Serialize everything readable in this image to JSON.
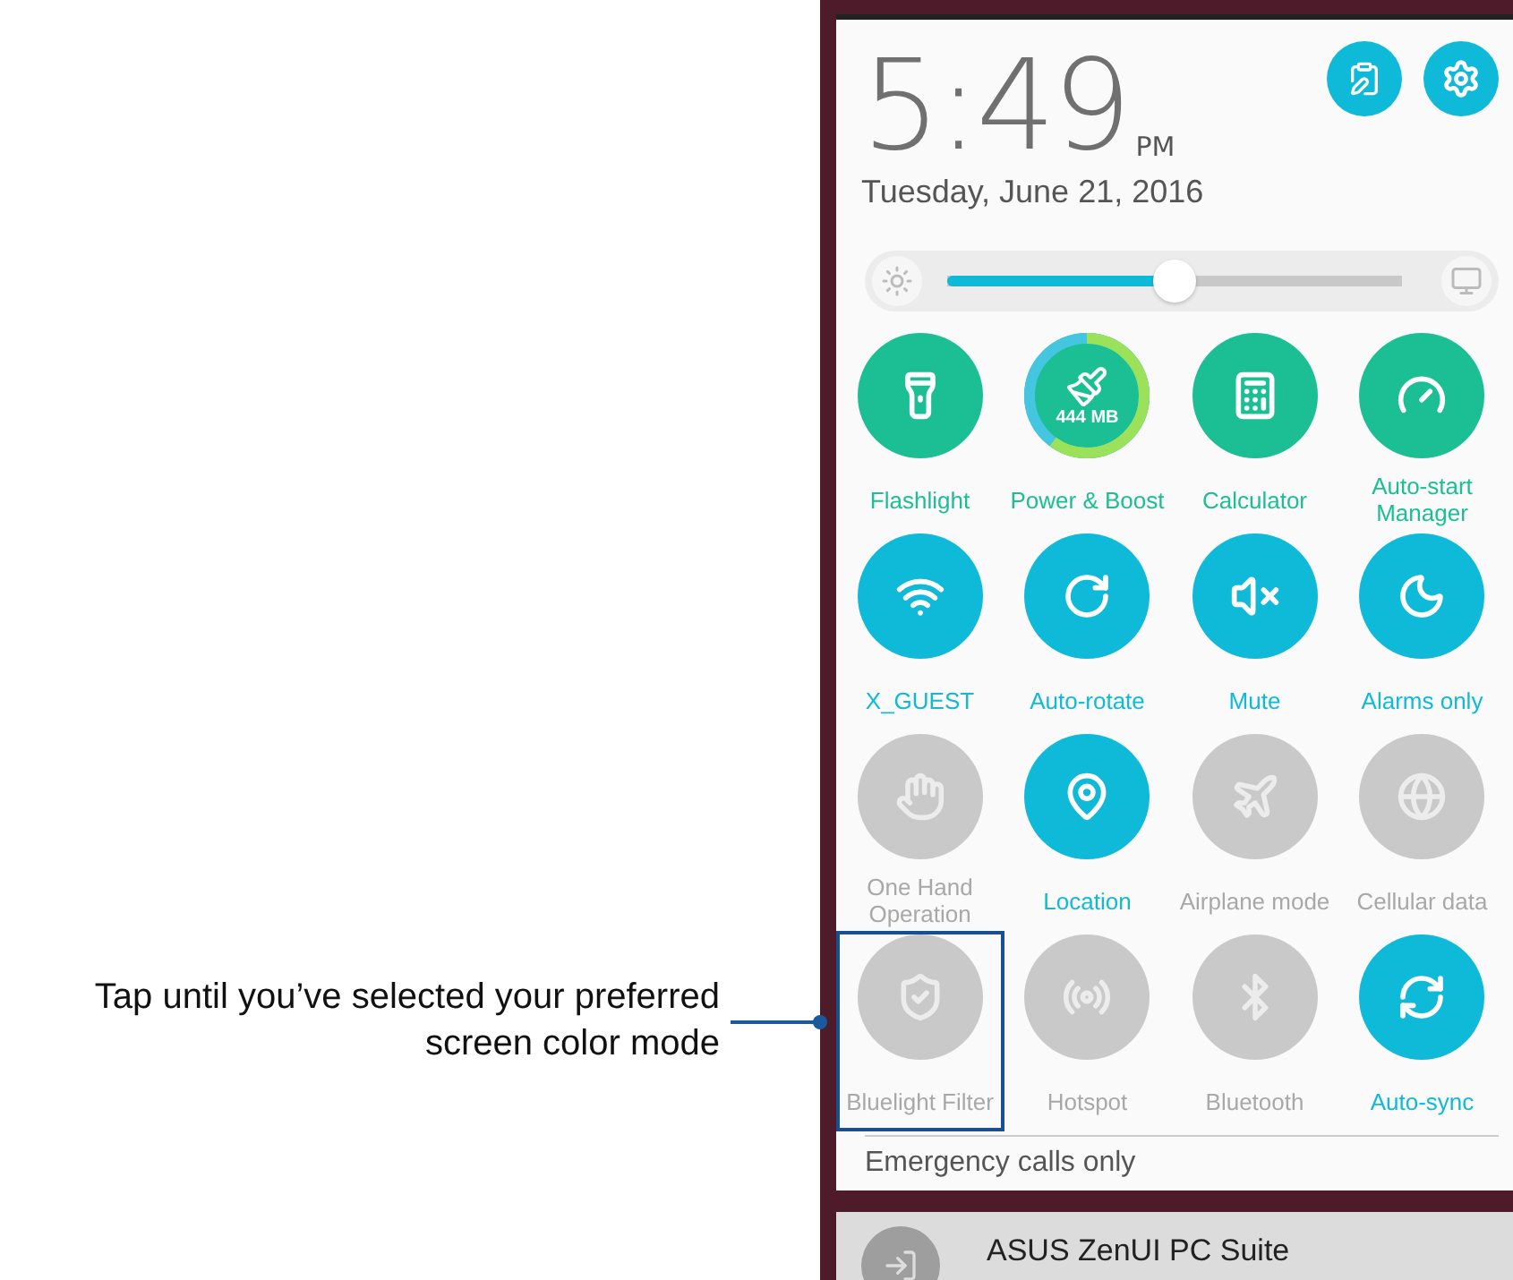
{
  "callout": {
    "text": "Tap until you’ve selected your preferred screen color mode"
  },
  "clock": {
    "time": "5:49",
    "meridiem": "PM",
    "date": "Tuesday, June 21, 2016"
  },
  "brightness": {
    "level": 0.5
  },
  "tiles": [
    {
      "label": "Flashlight",
      "kind": "toggle",
      "on": true,
      "color": "#1bbf93",
      "highlighted": false
    },
    {
      "label": "Power & Boost",
      "kind": "gauge",
      "on": true,
      "color": "#1bbf93",
      "highlighted": false,
      "reading": "444 MB"
    },
    {
      "label": "Calculator",
      "kind": "toggle",
      "on": true,
      "color": "#1bbf93",
      "highlighted": false
    },
    {
      "label": "Auto-start Manager",
      "kind": "toggle",
      "on": true,
      "color": "#1bbf93",
      "highlighted": false
    },
    {
      "label": "X_GUEST",
      "kind": "toggle",
      "on": true,
      "color": "#0fbad9",
      "highlighted": false
    },
    {
      "label": "Auto-rotate",
      "kind": "toggle",
      "on": true,
      "color": "#0fbad9",
      "highlighted": false
    },
    {
      "label": "Mute",
      "kind": "toggle",
      "on": true,
      "color": "#0fbad9",
      "highlighted": false
    },
    {
      "label": "Alarms only",
      "kind": "toggle",
      "on": true,
      "color": "#0fbad9",
      "highlighted": false
    },
    {
      "label": "One Hand Operation",
      "kind": "toggle",
      "on": false,
      "color": "#c9c9c9",
      "highlighted": false
    },
    {
      "label": "Location",
      "kind": "toggle",
      "on": true,
      "color": "#0fbad9",
      "highlighted": false
    },
    {
      "label": "Airplane mode",
      "kind": "toggle",
      "on": false,
      "color": "#c9c9c9",
      "highlighted": false
    },
    {
      "label": "Cellular data",
      "kind": "toggle",
      "on": false,
      "color": "#c9c9c9",
      "highlighted": false
    },
    {
      "label": "Bluelight Filter",
      "kind": "toggle",
      "on": false,
      "color": "#c9c9c9",
      "highlighted": true
    },
    {
      "label": "Hotspot",
      "kind": "toggle",
      "on": false,
      "color": "#c9c9c9",
      "highlighted": false
    },
    {
      "label": "Bluetooth",
      "kind": "toggle",
      "on": false,
      "color": "#c9c9c9",
      "highlighted": false
    },
    {
      "label": "Auto-sync",
      "kind": "toggle",
      "on": true,
      "color": "#0fbad9",
      "highlighted": false
    }
  ],
  "status": {
    "text": "Emergency calls only"
  },
  "notification": {
    "title": "ASUS ZenUI PC Suite"
  }
}
